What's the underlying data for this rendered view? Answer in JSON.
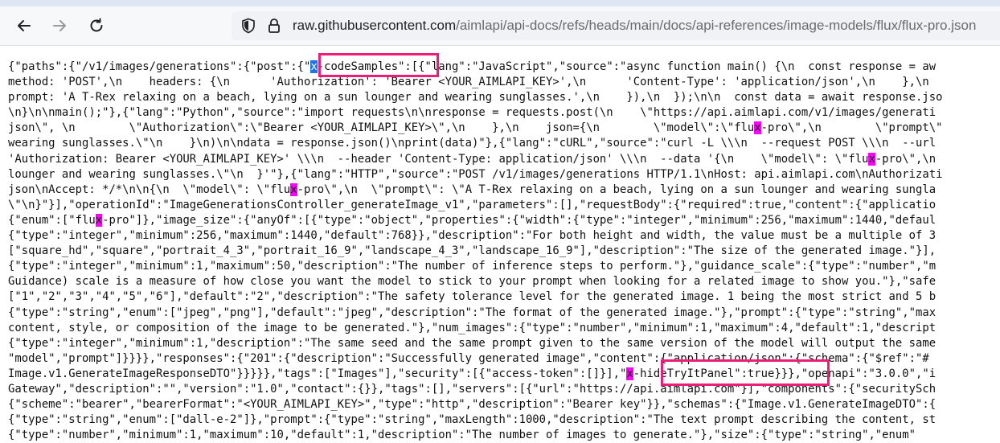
{
  "browser": {
    "url": {
      "host": "raw.githubusercontent.com",
      "path": "/aimlapi/api-docs/refs/heads/main/docs/api-references/image-models/flux/flux-pro.json"
    }
  },
  "document": {
    "lines": [
      [
        {
          "t": "{\"paths\":{\"/v1/images/generations\":{\"post\":{\""
        },
        {
          "t": "x",
          "m": "sel"
        },
        {
          "t": "-codeSamples\":[{\"lang\":\"JavaScript\",\"source\":\"async function main() {\\n  const response = aw"
        }
      ],
      [
        {
          "t": "method: 'POST',\\n    headers: {\\n      'Authorization': 'Bearer <YOUR_AIMLAPI_KEY>',\\n      'Content-Type': 'application/json',\\n    },\\n"
        }
      ],
      [
        {
          "t": "prompt: 'A T-Rex relaxing on a beach, lying on a sun lounger and wearing sunglasses.',\\n    }),\\n  });\\n\\n  const data = await response.jso"
        }
      ],
      [
        {
          "t": "\\n}\\n\\nmain();\"},{\"lang\":\"Python\",\"source\":\"import requests\\n\\nresponse = requests.post(\\n    \\\"https://api.aimlapi.com/v1/images/generati"
        }
      ],
      [
        {
          "t": "json\\\", \\n        \\\"Authorization\\\":\\\"Bearer <YOUR_AIMLAPI_KEY>\\\",\\n    },\\n    json={\\n        \\\"model\\\":\\\"flu"
        },
        {
          "t": "x",
          "m": "hl"
        },
        {
          "t": "-pro\\\",\\n        \\\"prompt\\\""
        }
      ],
      [
        {
          "t": "wearing sunglasses.\\\"\\n    }\\n)\\n\\ndata = response.json()\\nprint(data)\"},{\"lang\":\"cURL\",\"source\":\"curl -L \\\\\\n  --request POST \\\\\\n  --url"
        }
      ],
      [
        {
          "t": "'Authorization: Bearer <YOUR_AIMLAPI_KEY>' \\\\\\n  --header 'Content-Type: application/json' \\\\\\n  --data '{\\n    \\\"model\\\": \\\"flu"
        },
        {
          "t": "x",
          "m": "hl"
        },
        {
          "t": "-pro\\\",\\n"
        }
      ],
      [
        {
          "t": "lounger and wearing sunglasses.\\\"\\n  }'\"},{\"lang\":\"HTTP\",\"source\":\"POST /v1/images/generations HTTP/1.1\\nHost: api.aimlapi.com\\nAuthorizati"
        }
      ],
      [
        {
          "t": "json\\nAccept: */*\\n\\n{\\n  \\\"model\\\": \\\"flu"
        },
        {
          "t": "x",
          "m": "hl"
        },
        {
          "t": "-pro\\\",\\n  \\\"prompt\\\": \\\"A T-Rex relaxing on a beach, lying on a sun lounger and wearing sungla"
        }
      ],
      [
        {
          "t": "\\\"\\n}\"}],\"operationId\":\"ImageGenerationsController_generateImage_v1\",\"parameters\":[],\"requestBody\":{\"required\":true,\"content\":{\"applicatio"
        }
      ],
      [
        {
          "t": "{\"enum\":[\"flu"
        },
        {
          "t": "x",
          "m": "hl"
        },
        {
          "t": "-pro\"]},\"image_size\":{\"anyOf\":[{\"type\":\"object\",\"properties\":{\"width\":{\"type\":\"integer\",\"minimum\":256,\"maximum\":1440,\"defaul"
        }
      ],
      [
        {
          "t": "{\"type\":\"integer\",\"minimum\":256,\"maximum\":1440,\"default\":768}},\"description\":\"For both height and width, the value must be a multiple of 3"
        }
      ],
      [
        {
          "t": "[\"square_hd\",\"square\",\"portrait_4_3\",\"portrait_16_9\",\"landscape_4_3\",\"landscape_16_9\"],\"description\":\"The size of the generated image.\"}],"
        }
      ],
      [
        {
          "t": "{\"type\":\"integer\",\"minimum\":1,\"maximum\":50,\"description\":\"The number of inference steps to perform.\"},\"guidance_scale\":{\"type\":\"number\",\"m"
        }
      ],
      [
        {
          "t": "Guidance) scale is a measure of how close you want the model to stick to your prompt when looking for a related image to show you.\"},\"safe"
        }
      ],
      [
        {
          "t": "[\"1\",\"2\",\"3\",\"4\",\"5\",\"6\"],\"default\":\"2\",\"description\":\"The safety tolerance level for the generated image. 1 being the most strict and 5 b"
        }
      ],
      [
        {
          "t": "{\"type\":\"string\",\"enum\":[\"jpeg\",\"png\"],\"default\":\"jpeg\",\"description\":\"The format of the generated image.\"},\"prompt\":{\"type\":\"string\",\"max"
        }
      ],
      [
        {
          "t": "content, style, or composition of the image to be generated.\"},\"num_images\":{\"type\":\"number\",\"minimum\":1,\"maximum\":4,\"default\":1,\"descript"
        }
      ],
      [
        {
          "t": "{\"type\":\"integer\",\"minimum\":1,\"description\":\"The same seed and the same prompt given to the same version of the model will output the same"
        }
      ],
      [
        {
          "t": "\"model\",\"prompt\"]}}}},\"responses\":{\"201\":{\"description\":\"Successfully generated image\",\"content\":{\"application/json\":{\"schema\":{\"$ref\":\"#"
        }
      ],
      [
        {
          "t": "Image.v1.GenerateImageResponseDTO\"}}}}},\"tags\":[\"Images\"],\"security\":[{\"access-token\":[]}],\""
        },
        {
          "t": "x",
          "m": "hl"
        },
        {
          "t": "-hideTryItPanel\":true}}},\"openapi\":\"3.0.0\",\"i"
        }
      ],
      [
        {
          "t": "Gateway\",\"description\":\"\",\"version\":\"1.0\",\"contact\":{}},\"tags\":[],\"servers\":[{\"url\":\"https://api.aimlapi.com\"}],\"components\":{\"securitySch"
        }
      ],
      [
        {
          "t": "{\"scheme\":\"bearer\",\"bearerFormat\":\"<YOUR_AIMLAPI_KEY>\",\"type\":\"http\",\"description\":\"Bearer key\"}},\"schemas\":{\"Image.v1.GenerateImageDTO\":{"
        }
      ],
      [
        {
          "t": "{\"type\":\"string\",\"enum\":[\"dall-e-2\"]},\"prompt\":{\"type\":\"string\",\"maxLength\":1000,\"description\":\"The text prompt describing the content, st"
        }
      ],
      [
        {
          "t": "{\"type\":\"number\",\"minimum\":1,\"maximum\":10,\"default\":1,\"description\":\"The number of images to generate.\"},\"size\":{\"type\":\"string\",\"enum\""
        }
      ]
    ]
  },
  "colors": {
    "highlight": "#ff00ff",
    "selection": "#1a73e8",
    "annotation_box": "#ec1e78"
  },
  "icons": {
    "back": "arrow-left-icon",
    "forward": "arrow-right-icon",
    "reload": "reload-icon",
    "tracking": "shield-icon",
    "security": "lock-icon"
  }
}
